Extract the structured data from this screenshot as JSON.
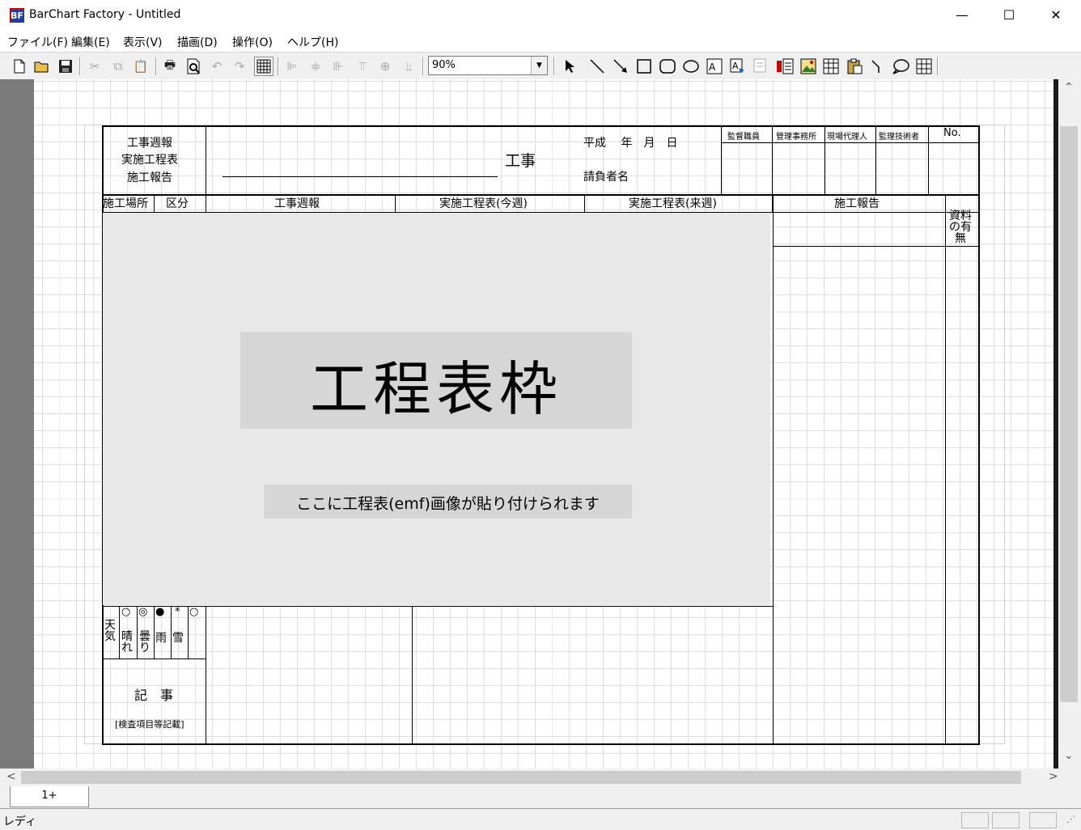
{
  "window": {
    "icon_text": "BF",
    "title": "BarChart Factory - Untitled",
    "minimize": "—",
    "maximize": "☐",
    "close": "✕"
  },
  "menu": {
    "items": [
      {
        "label": "ファイル(F)"
      },
      {
        "label": "編集(E)"
      },
      {
        "label": "表示(V)"
      },
      {
        "label": "描画(D)"
      },
      {
        "label": "操作(O)"
      },
      {
        "label": "ヘルプ(H)"
      }
    ]
  },
  "toolbar": {
    "zoom_value": "90%",
    "zoom_drop": "▼"
  },
  "sheet": {
    "header": {
      "title_l1": "工事週報",
      "title_l2": "実施工程表",
      "title_l3": "施工報告",
      "koji": "工事",
      "date": "平成　 年　月　日",
      "contractor": "請負者名",
      "stamp_cols": [
        "監督職員",
        "管理事務所",
        "現場代理人",
        "監理技術者"
      ],
      "no": "No."
    },
    "columns": {
      "location": "施工場所",
      "category": "区分",
      "weekly": "工事週報",
      "this_week": "実施工程表(今週)",
      "next_week": "実施工程表(来週)",
      "report": "施工報告",
      "materials_1": "資料",
      "materials_2": "の有",
      "materials_3": "無"
    },
    "emf": {
      "title": "工程表枠",
      "subtitle": "ここに工程表(emf)画像が貼り付けられます"
    },
    "weather": {
      "label": "天気",
      "symbols": [
        "○",
        "◎",
        "●",
        "*",
        "○"
      ],
      "sunny": "晴れ",
      "cloudy": "曇り",
      "rain": "雨",
      "snow": "雪"
    },
    "notes": {
      "label": "記　事",
      "sub": "[検査項目等記載]"
    }
  },
  "scroll": {
    "up": "⌃",
    "down": "⌄",
    "left": "<",
    "right": ">"
  },
  "tabs": {
    "active": "1+"
  },
  "status": {
    "text": "レディ"
  }
}
